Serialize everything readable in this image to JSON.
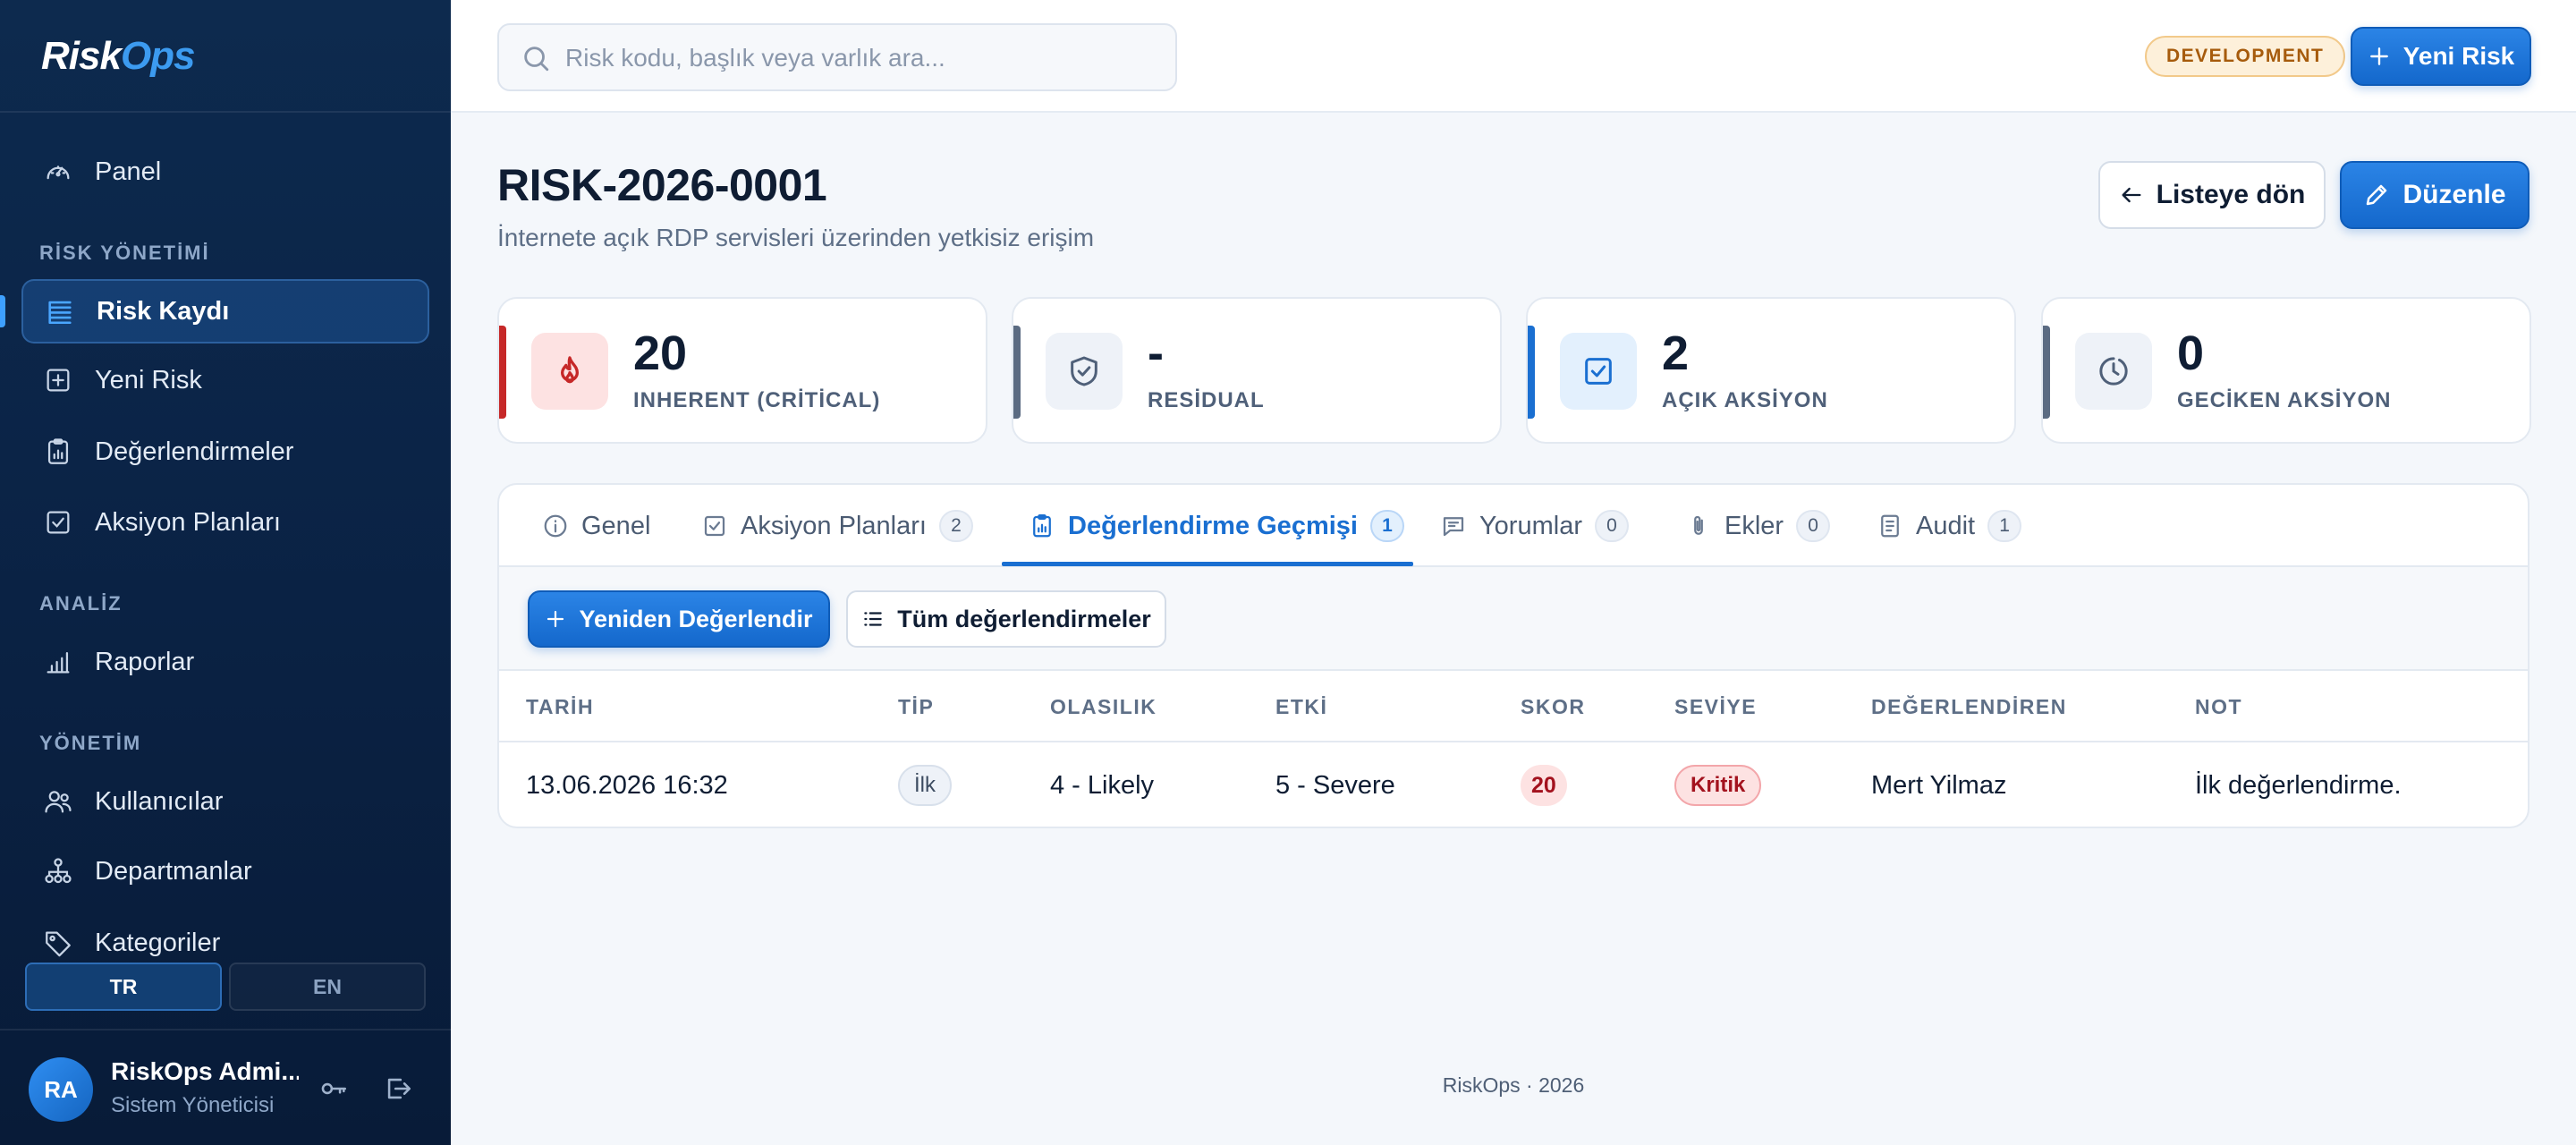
{
  "app": {
    "logo_part1": "Risk",
    "logo_part2": "Ops"
  },
  "sidebar": {
    "panel_label": "Panel",
    "sections": {
      "risk": "RİSK YÖNETİMİ",
      "analysis": "ANALİZ",
      "admin": "YÖNETİM"
    },
    "items": {
      "risk_register": "Risk Kaydı",
      "new_risk": "Yeni Risk",
      "assessments": "Değerlendirmeler",
      "action_plans": "Aksiyon Planları",
      "reports": "Raporlar",
      "users": "Kullanıcılar",
      "departments": "Departmanlar",
      "categories": "Kategoriler"
    },
    "active_item": "Risk Kaydı",
    "languages": {
      "tr": "TR",
      "en": "EN",
      "selected": "TR"
    },
    "user": {
      "initials": "RA",
      "name": "RiskOps Admi...",
      "role": "Sistem Yöneticisi"
    }
  },
  "topbar": {
    "search_placeholder": "Risk kodu, başlık veya varlık ara...",
    "env_badge": "DEVELOPMENT",
    "new_risk_button": "Yeni Risk"
  },
  "header": {
    "title": "RISK-2026-0001",
    "subtitle": "İnternete açık RDP servisleri üzerinden yetkisiz erişim",
    "back_button": "Listeye dön",
    "edit_button": "Düzenle"
  },
  "kpis": [
    {
      "value": "20",
      "label": "INHERENT (CRİTİCAL)",
      "accent": "#c62828",
      "icon": "flame-icon"
    },
    {
      "value": "-",
      "label": "RESİDUAL",
      "accent": "#5b6b82",
      "icon": "shield-icon"
    },
    {
      "value": "2",
      "label": "AÇIK AKSİYON",
      "accent": "#1a6fd1",
      "icon": "checkbox-icon"
    },
    {
      "value": "0",
      "label": "GECİKEN AKSİYON",
      "accent": "#5b6b82",
      "icon": "clock-icon"
    }
  ],
  "tabs": [
    {
      "label": "Genel",
      "icon": "info-icon"
    },
    {
      "label": "Aksiyon Planları",
      "count": "2",
      "icon": "checkbox-icon"
    },
    {
      "label": "Değerlendirme Geçmişi",
      "count": "1",
      "icon": "clipboard-icon",
      "active": true
    },
    {
      "label": "Yorumlar",
      "count": "0",
      "icon": "comment-icon"
    },
    {
      "label": "Ekler",
      "count": "0",
      "icon": "paperclip-icon"
    },
    {
      "label": "Audit",
      "count": "1",
      "icon": "document-icon"
    }
  ],
  "toolbar": {
    "reassess_button": "Yeniden Değerlendir",
    "all_assessments_button": "Tüm değerlendirmeler"
  },
  "table": {
    "columns": [
      "TARİH",
      "TİP",
      "OLASILIK",
      "ETKİ",
      "SKOR",
      "SEVİYE",
      "DEĞERLENDİREN",
      "NOT"
    ],
    "rows": [
      {
        "date": "13.06.2026 16:32",
        "type": "İlk",
        "likelihood": "4 - Likely",
        "impact": "5 - Severe",
        "score": "20",
        "level": "Kritik",
        "assessor": "Mert Yilmaz",
        "note": "İlk değerlendirme."
      }
    ]
  },
  "footer": "RiskOps · 2026",
  "colors": {
    "sidebar_bg": "#0b2447",
    "primary": "#1a6fd1",
    "critical": "#c62828",
    "env_badge": "#a65b0c"
  }
}
